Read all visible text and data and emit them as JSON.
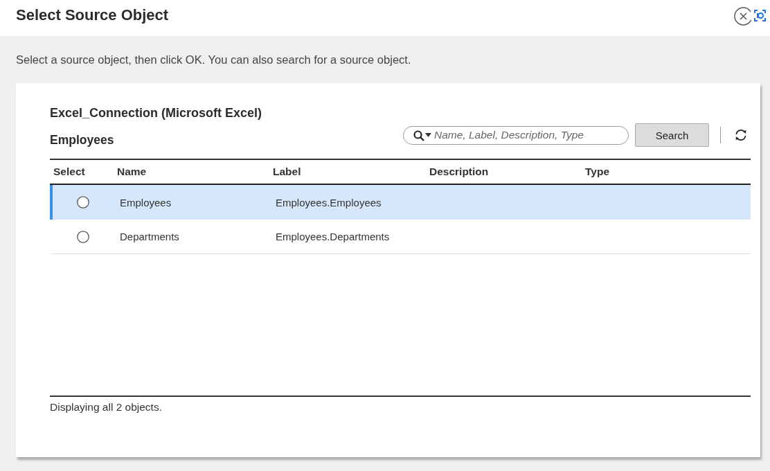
{
  "dialog": {
    "title": "Select Source Object",
    "instructions": "Select a source object, then click OK. You can also search for a source object."
  },
  "source": {
    "connection": "Excel_Connection (Microsoft Excel)",
    "object": "Employees"
  },
  "search": {
    "placeholder": "Name, Label, Description, Type",
    "button": "Search"
  },
  "table": {
    "columns": [
      "Select",
      "Name",
      "Label",
      "Description",
      "Type"
    ],
    "rows": [
      {
        "name": "Employees",
        "label": "Employees.Employees",
        "selected": true,
        "checked": false
      },
      {
        "name": "Departments",
        "label": "Employees.Departments",
        "selected": false,
        "checked": false
      }
    ]
  },
  "status_bar": "Displaying all 2 objects."
}
